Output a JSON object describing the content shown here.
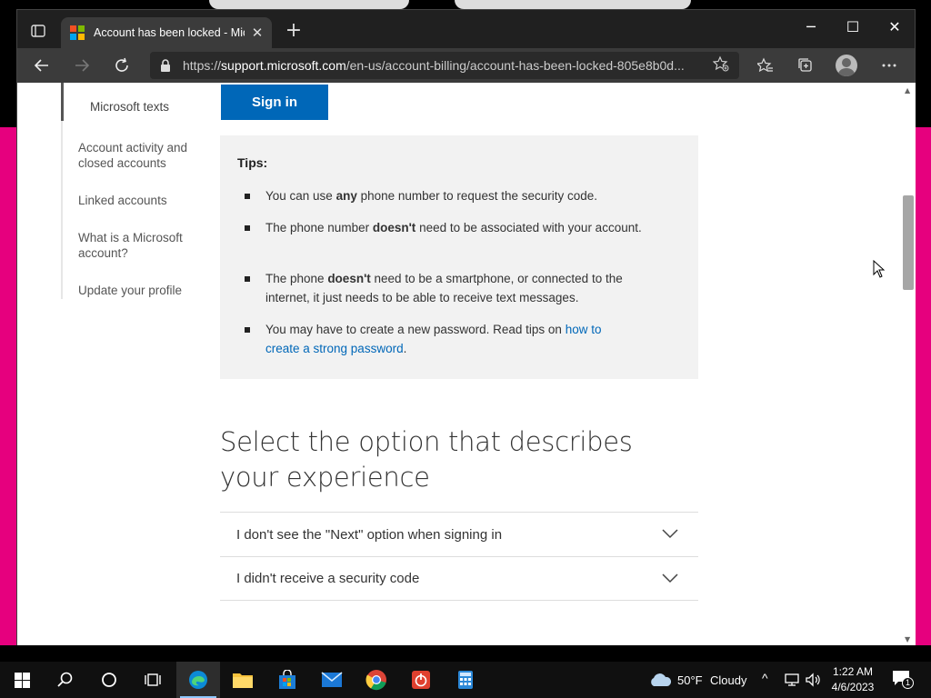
{
  "browser": {
    "tab_title": "Account has been locked - Micro",
    "tab_close": "✕",
    "new_tab": "+",
    "url_prefix": "https://",
    "url_host": "support.microsoft.com",
    "url_path": "/en-us/account-billing/account-has-been-locked-805e8b0d...",
    "win_minimize": "─",
    "win_maximize": "☐",
    "win_close": "✕"
  },
  "sidebar": {
    "items": [
      {
        "label": "Microsoft texts"
      },
      {
        "label": "Account activity and closed accounts"
      },
      {
        "label": "Linked accounts"
      },
      {
        "label": "What is a Microsoft account?"
      },
      {
        "label": "Update your profile"
      }
    ]
  },
  "content": {
    "signin_label": "Sign in",
    "tips_title": "Tips:",
    "tips": [
      {
        "pre": "You can use ",
        "bold": "any",
        "post": " phone number to request the security code."
      },
      {
        "pre": "The phone number ",
        "bold": "doesn't",
        "post": " need to be associated with your account."
      },
      {
        "pre": "The phone ",
        "bold": "doesn't",
        "post": " need to be a smartphone, or connected to the internet, it just needs to be able to receive text messages."
      },
      {
        "pre": "You may have to create a new password. Read tips on ",
        "link": "how to create a strong password",
        "post": "."
      }
    ],
    "heading": "Select the option that describes your experience",
    "accordion": [
      {
        "label": "I don't see the \"Next\" option when signing in"
      },
      {
        "label": "I didn't receive a security code"
      }
    ]
  },
  "taskbar": {
    "weather_temp": "50°F",
    "weather_desc": "Cloudy",
    "time": "1:22 AM",
    "date": "4/6/2023",
    "notification_count": "1"
  },
  "colors": {
    "accent": "#0067b8",
    "desktop_pink": "#e6007e",
    "tips_bg": "#f2f2f2"
  }
}
